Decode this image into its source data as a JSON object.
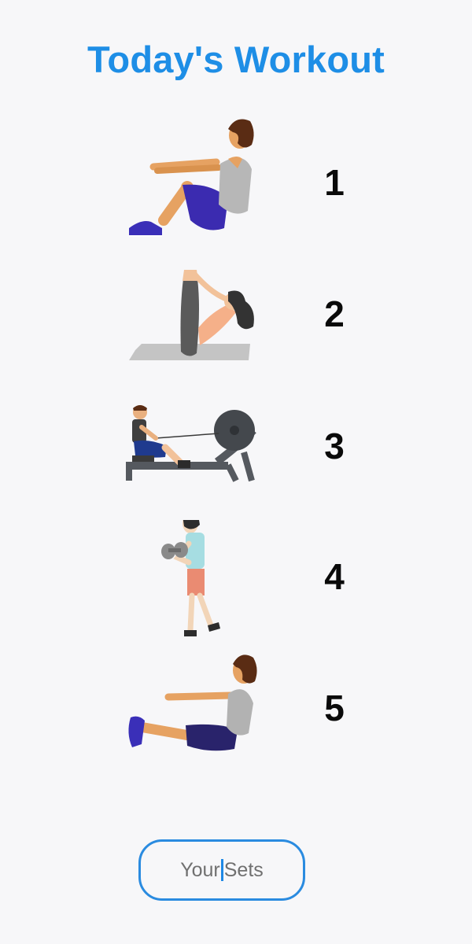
{
  "header": {
    "title": "Today's Workout"
  },
  "workout": {
    "exercises": [
      {
        "number": "1",
        "icon": "situp-exercise-icon"
      },
      {
        "number": "2",
        "icon": "leg-raise-crunch-icon"
      },
      {
        "number": "3",
        "icon": "rowing-machine-icon"
      },
      {
        "number": "4",
        "icon": "dumbbell-walk-icon"
      },
      {
        "number": "5",
        "icon": "v-sit-exercise-icon"
      }
    ]
  },
  "sets_button": {
    "text_before_caret": "Your",
    "text_after_caret": "Sets"
  },
  "colors": {
    "title": "#1e8ee6",
    "button_border": "#2a8be0",
    "background": "#f7f7f9"
  }
}
